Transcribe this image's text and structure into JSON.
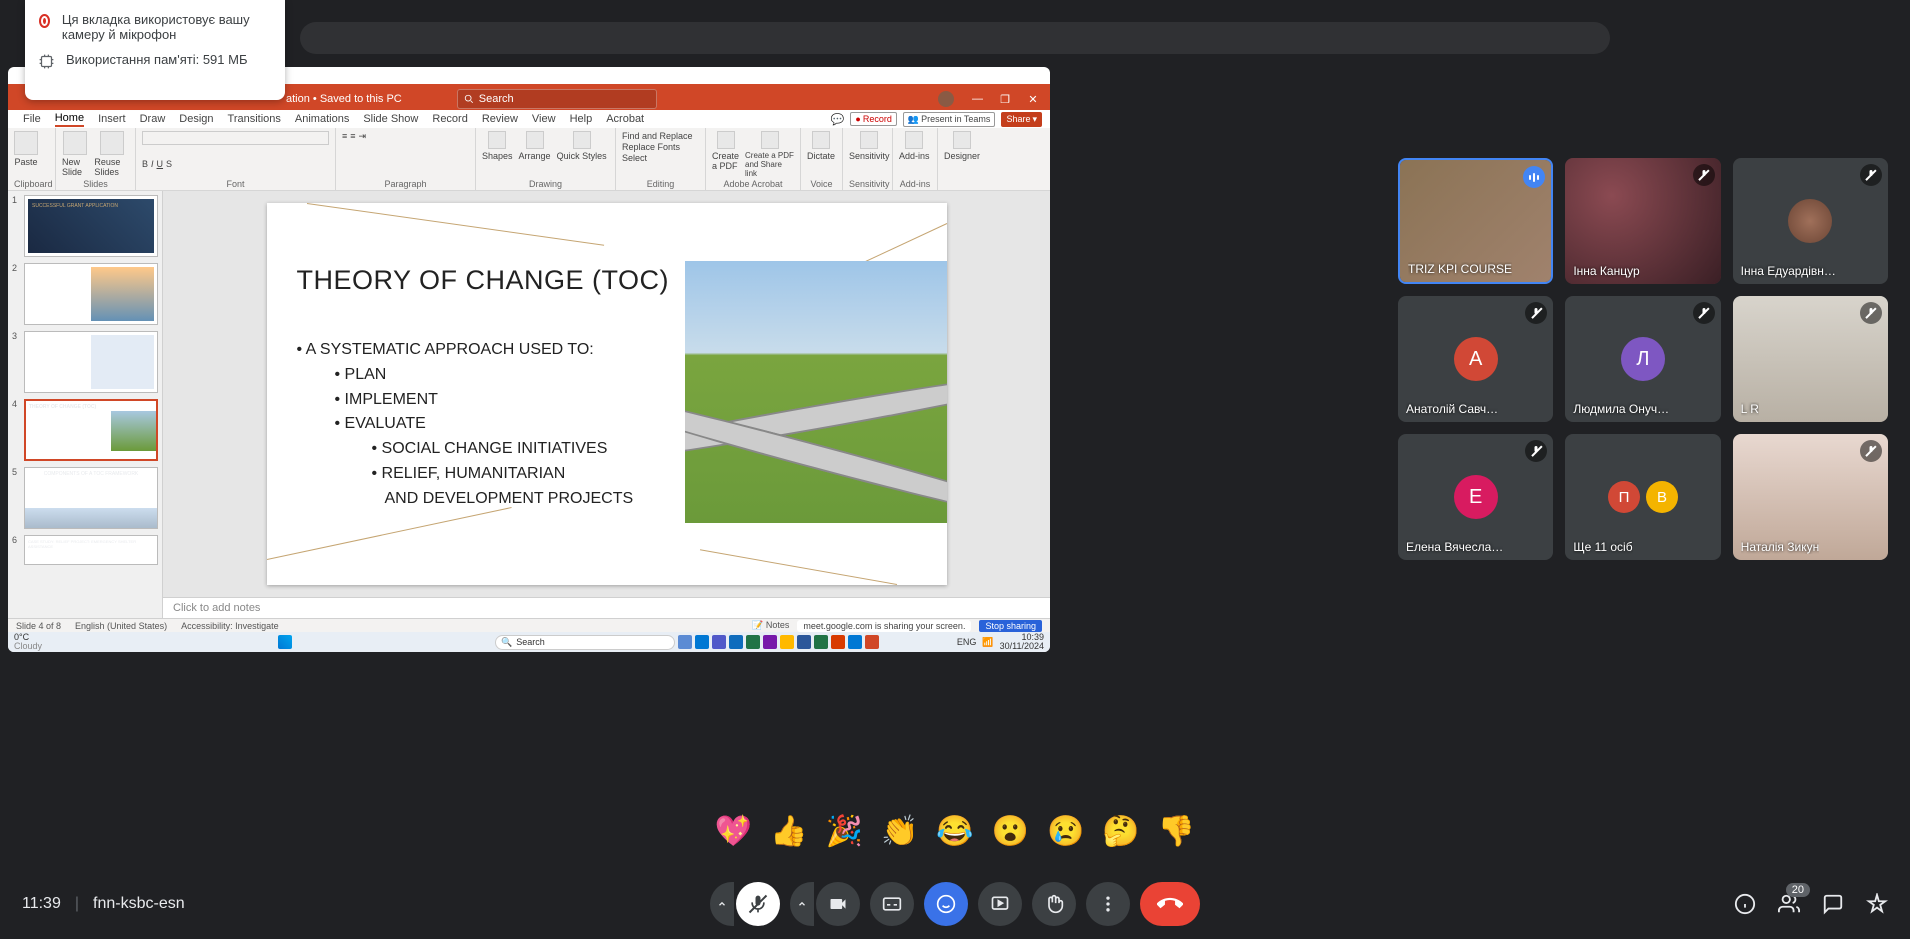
{
  "browser_tab_info": {
    "line1": "Ця вкладка використовує вашу камеру й мікрофон",
    "line2": "Використання пам'яті: 591 МБ"
  },
  "powerpoint": {
    "doc_status": "ation • Saved to this PC",
    "search_placeholder": "Search",
    "window_controls": {
      "min": "—",
      "max": "❐",
      "close": "✕"
    },
    "tabs": [
      "File",
      "Home",
      "Insert",
      "Draw",
      "Design",
      "Transitions",
      "Animations",
      "Slide Show",
      "Record",
      "Review",
      "View",
      "Help",
      "Acrobat"
    ],
    "ribbon_right": {
      "record": "Record",
      "present": "Present in Teams",
      "share": "Share"
    },
    "ribbon_groups": {
      "clipboard": {
        "paste": "Paste",
        "label": "Clipboard"
      },
      "slides": {
        "new": "New Slide",
        "reuse": "Reuse Slides",
        "label": "Slides"
      },
      "font": {
        "label": "Font"
      },
      "para": {
        "label": "Paragraph"
      },
      "drawing": {
        "shapes": "Shapes",
        "arrange": "Arrange",
        "quick": "Quick Styles",
        "label": "Drawing"
      },
      "editing": {
        "find": "Find and Replace",
        "replace": "Replace Fonts",
        "select": "Select",
        "label": "Editing"
      },
      "adobe": {
        "create": "Create a PDF",
        "share": "Create a PDF and Share link",
        "label": "Adobe Acrobat"
      },
      "voice": {
        "dictate": "Dictate",
        "label": "Voice"
      },
      "sens": {
        "btn": "Sensitivity",
        "label": "Sensitivity"
      },
      "addins": {
        "btn": "Add-ins",
        "label": "Add-ins"
      },
      "designer": {
        "btn": "Designer"
      }
    },
    "slide": {
      "title": "THEORY OF CHANGE (TOC)",
      "b1": "A SYSTEMATIC APPROACH USED TO:",
      "b2a": "PLAN",
      "b2b": "IMPLEMENT",
      "b2c": "EVALUATE",
      "b3a": "SOCIAL CHANGE INITIATIVES",
      "b3b": "RELIEF, HUMANITARIAN",
      "b3c": "AND DEVELOPMENT PROJECTS"
    },
    "thumbs": {
      "t1": "SUCCESSFUL GRANT APPLICATION",
      "t4": "THEORY OF CHANGE (TOC)",
      "t5": "COMPONENTS OF A TOC FRAMEWORK",
      "t6": "CASE STUDY: RELIEF PROJECT: EMERGENCY SHELTER ASSISTANCE"
    },
    "notes_placeholder": "Click to add notes",
    "status": {
      "slide": "Slide 4 of 8",
      "lang": "English (United States)",
      "access": "Accessibility: Investigate",
      "notes": "Notes",
      "sharing": "meet.google.com is sharing your screen.",
      "stop": "Stop sharing"
    }
  },
  "taskbar": {
    "temp": "0°C",
    "cond": "Cloudy",
    "search": "Search",
    "lang": "ENG",
    "time": "10:39",
    "date": "30/11/2024"
  },
  "participants": [
    {
      "name": "TRIZ KPI COURSE",
      "type": "video",
      "speaking": true
    },
    {
      "name": "Інна Канцур",
      "type": "video",
      "muted": true
    },
    {
      "name": "Інна Едуардівн…",
      "type": "avatar",
      "muted": true,
      "photo": true
    },
    {
      "name": "Анатолій Савч…",
      "type": "avatar",
      "muted": true,
      "letter": "А",
      "color": "#d14836"
    },
    {
      "name": "Людмила Онуч…",
      "type": "avatar",
      "muted": true,
      "letter": "Л",
      "color": "#7e57c2"
    },
    {
      "name": "L R",
      "type": "video",
      "muted": true
    },
    {
      "name": "Елена Вячесла…",
      "type": "avatar",
      "muted": true,
      "letter": "Е",
      "color": "#d81b60"
    },
    {
      "name": "Ще 11 осіб",
      "type": "multi"
    },
    {
      "name": "Наталія Зикун",
      "type": "video",
      "muted": true
    }
  ],
  "reactions": [
    "💖",
    "👍",
    "🎉",
    "👏",
    "😂",
    "😮",
    "😢",
    "🤔",
    "👎"
  ],
  "meet": {
    "time": "11:39",
    "code": "fnn-ksbc-esn",
    "people_count": "20"
  }
}
